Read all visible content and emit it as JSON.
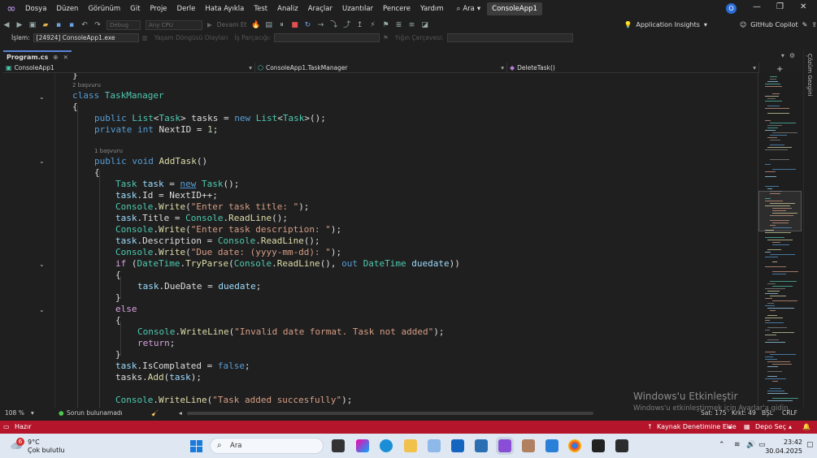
{
  "menu": {
    "items": [
      "Dosya",
      "Düzen",
      "Görünüm",
      "Git",
      "Proje",
      "Derle",
      "Hata Ayıkla",
      "Test",
      "Analiz",
      "Araçlar",
      "Uzantılar",
      "Pencere",
      "Yardım"
    ],
    "search_label": "Ara",
    "app_name": "ConsoleApp1",
    "profile_initial": "O"
  },
  "toolbar": {
    "config": "Debug",
    "platform": "Any CPU",
    "continue_label": "Devam Et",
    "insights": "Application Insights",
    "copilot": "GitHub Copilot"
  },
  "debugbar": {
    "process_label": "İşlem:",
    "process_value": "[24924] ConsoleApp1.exe",
    "lifecycle_label": "Yaşam Döngüsü Olayları",
    "thread_label": "İş Parçacığı:",
    "stackframe_label": "Yığın Çerçevesi:"
  },
  "tab": {
    "title": "Program.cs"
  },
  "rail": {
    "label": "Çözüm Gezgini"
  },
  "nav": {
    "project": "ConsoleApp1",
    "class": "ConsoleApp1.TaskManager",
    "member": "DeleteTask()"
  },
  "code": {
    "refs_class": "2 başvuru",
    "refs_method": "1 başvuru"
  },
  "editor_status": {
    "zoom": "108 %",
    "issues": "Sorun bulunamadı",
    "line": "Sat: 175",
    "char": "Krkt: 49",
    "mode": "BŞL",
    "eol": "CRLF"
  },
  "watermark": {
    "title": "Windows'u Etkinleştir",
    "subtitle": "Windows'u etkinleştirmek için Ayarlar'a gidin."
  },
  "statusbar": {
    "ready": "Hazır",
    "source_control": "Kaynak Denetimine Ekle",
    "repo": "Depo Seç"
  },
  "taskbar": {
    "temperature": "9°C",
    "weather": "Çok bulutlu",
    "weather_badge": "6",
    "search": "Ara",
    "time": "23:42",
    "date": "30.04.2025"
  },
  "colors": {
    "status_bar": "#b4152b",
    "keyword": "#569cd6",
    "type": "#4ec9b0",
    "string": "#d69d85"
  }
}
